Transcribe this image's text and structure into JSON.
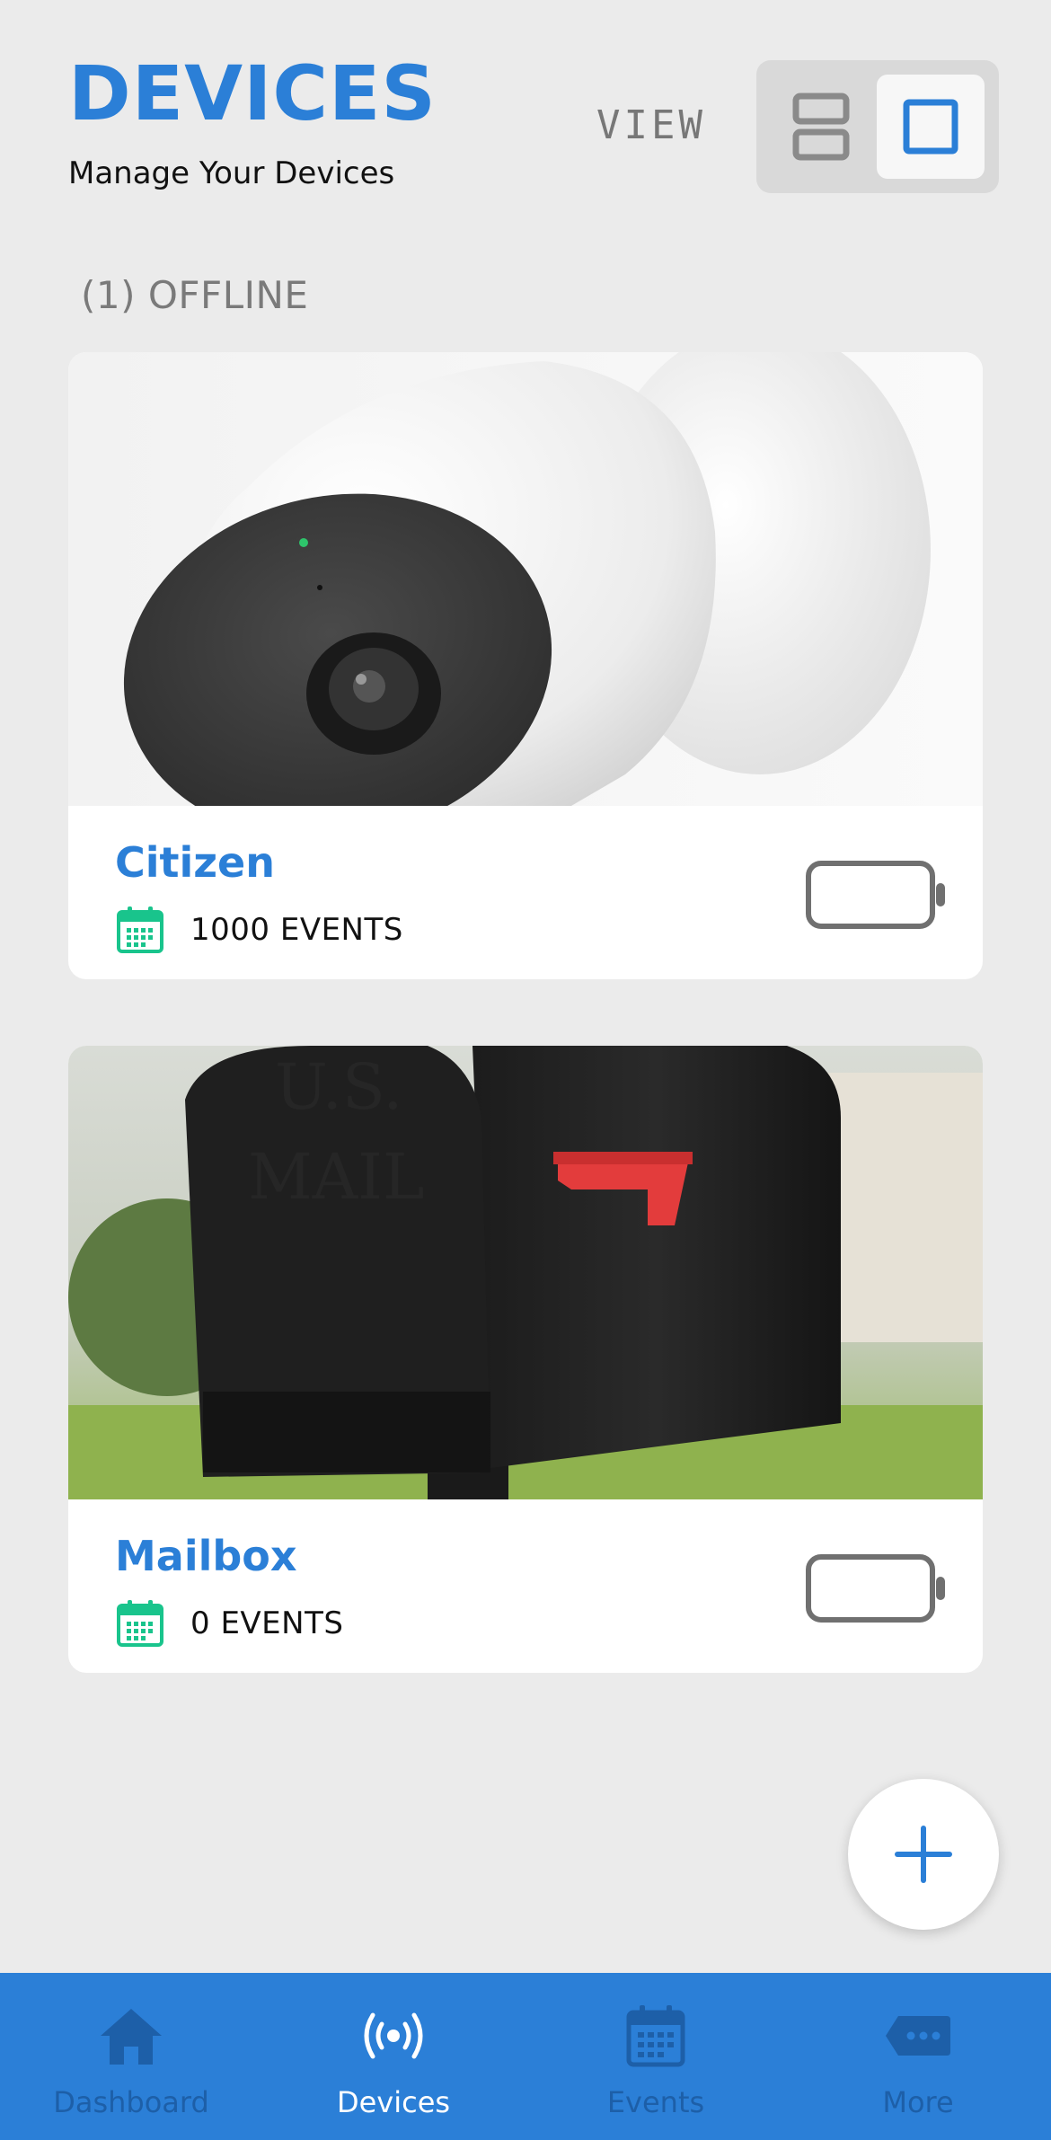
{
  "header": {
    "title": "DEVICES",
    "subtitle": "Manage Your Devices",
    "view_label": "VIEW",
    "view_toggle": {
      "options": [
        "list-view-icon",
        "grid-view-icon"
      ],
      "selected": "grid-view-icon"
    }
  },
  "section": {
    "offline_label": "(1) OFFLINE"
  },
  "devices": [
    {
      "name": "Citizen",
      "events": "1000 EVENTS",
      "image": "security-camera-photo",
      "battery_icon": "battery-empty-icon"
    },
    {
      "name": "Mailbox",
      "events": "0 EVENTS",
      "image": "mailbox-photo",
      "battery_icon": "battery-empty-icon"
    }
  ],
  "fab": {
    "icon": "plus-icon"
  },
  "tabbar": {
    "items": [
      {
        "label": "Dashboard",
        "icon": "home-icon",
        "active": false
      },
      {
        "label": "Devices",
        "icon": "broadcast-icon",
        "active": true
      },
      {
        "label": "Events",
        "icon": "calendar-icon",
        "active": false
      },
      {
        "label": "More",
        "icon": "more-icon",
        "active": false
      }
    ]
  },
  "colors": {
    "accent": "#2b7fd7",
    "background": "#ebebeb",
    "calendar_icon": "#19c48c",
    "tab_inactive": "#1d5fa8"
  }
}
